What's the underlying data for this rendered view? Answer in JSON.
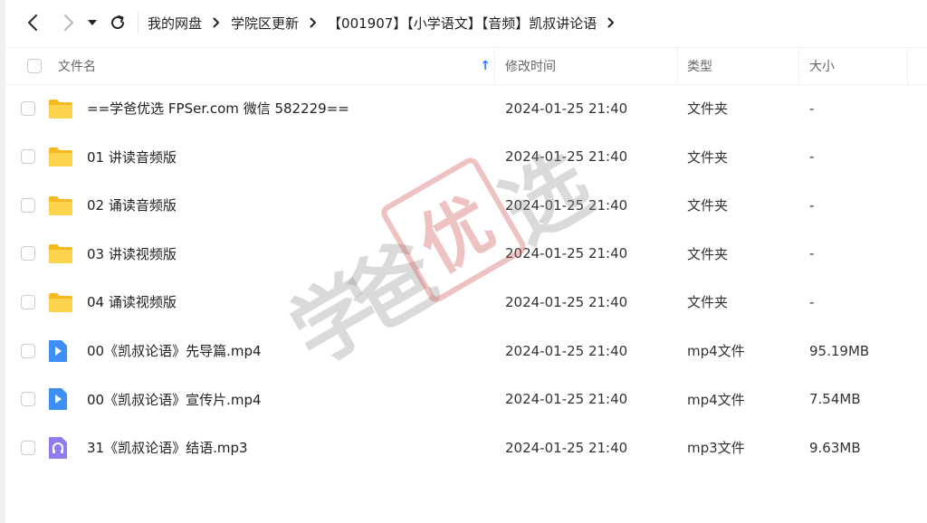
{
  "toolbar": {
    "back_icon": "chevron-left-icon",
    "forward_icon": "chevron-right-icon",
    "dropdown_icon": "caret-down-icon",
    "refresh_icon": "refresh-icon"
  },
  "breadcrumb": [
    {
      "label": "我的网盘"
    },
    {
      "label": "学院区更新"
    },
    {
      "label": "【001907】【小学语文】【音频】凯叔讲论语"
    }
  ],
  "table": {
    "columns": {
      "name": "文件名",
      "modified": "修改时间",
      "type": "类型",
      "size": "大小"
    },
    "sort_indicator": "↑",
    "rows": [
      {
        "icon": "folder-icon",
        "name": "==学爸优选 FPSer.com 微信 582229==",
        "modified": "2024-01-25 21:40",
        "type": "文件夹",
        "size": "-"
      },
      {
        "icon": "folder-icon",
        "name": "01 讲读音频版",
        "modified": "2024-01-25 21:40",
        "type": "文件夹",
        "size": "-"
      },
      {
        "icon": "folder-icon",
        "name": "02 诵读音频版",
        "modified": "2024-01-25 21:40",
        "type": "文件夹",
        "size": "-"
      },
      {
        "icon": "folder-icon",
        "name": "03 讲读视频版",
        "modified": "2024-01-25 21:40",
        "type": "文件夹",
        "size": "-"
      },
      {
        "icon": "folder-icon",
        "name": "04 诵读视频版",
        "modified": "2024-01-25 21:40",
        "type": "文件夹",
        "size": "-"
      },
      {
        "icon": "video-file-icon",
        "name": "00《凯叔论语》先导篇.mp4",
        "modified": "2024-01-25 21:40",
        "type": "mp4文件",
        "size": "95.19MB"
      },
      {
        "icon": "video-file-icon",
        "name": "00《凯叔论语》宣传片.mp4",
        "modified": "2024-01-25 21:40",
        "type": "mp4文件",
        "size": "7.54MB"
      },
      {
        "icon": "audio-file-icon",
        "name": "31《凯叔论语》结语.mp3",
        "modified": "2024-01-25 21:40",
        "type": "mp3文件",
        "size": "9.63MB"
      }
    ]
  },
  "watermark": {
    "chars": [
      "学",
      "爸",
      "优",
      "选"
    ]
  },
  "colors": {
    "folder": "#f7c948",
    "video": "#3d8ff5",
    "audio": "#8e7cf0",
    "sort_arrow": "#2f7bf5",
    "watermark_seal": "#d25050"
  }
}
